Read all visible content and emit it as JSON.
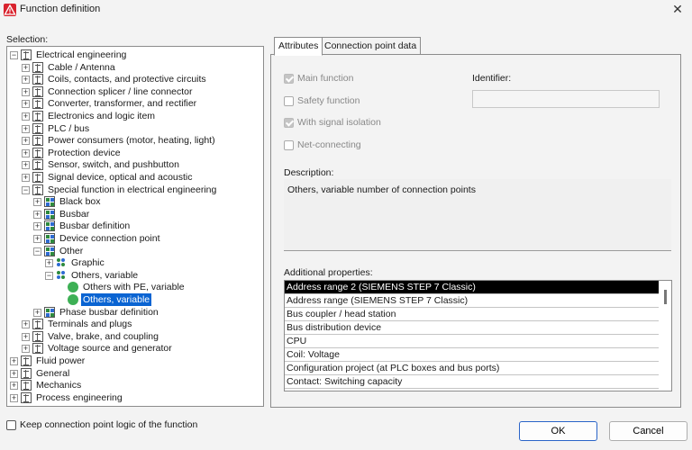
{
  "window": {
    "title": "Function definition"
  },
  "selection_label": "Selection:",
  "tree": [
    {
      "label": "Electrical engineering",
      "level": 0,
      "expander": "−",
      "icon": "grid-icon"
    },
    {
      "label": "Cable / Antenna",
      "level": 1,
      "expander": "+",
      "icon": "grid-icon"
    },
    {
      "label": "Coils, contacts, and protective circuits",
      "level": 1,
      "expander": "+",
      "icon": "grid-icon"
    },
    {
      "label": "Connection splicer / line connector",
      "level": 1,
      "expander": "+",
      "icon": "grid-icon"
    },
    {
      "label": "Converter, transformer, and rectifier",
      "level": 1,
      "expander": "+",
      "icon": "grid-icon"
    },
    {
      "label": "Electronics and logic item",
      "level": 1,
      "expander": "+",
      "icon": "grid-icon"
    },
    {
      "label": "PLC / bus",
      "level": 1,
      "expander": "+",
      "icon": "grid-icon"
    },
    {
      "label": "Power consumers (motor, heating, light)",
      "level": 1,
      "expander": "+",
      "icon": "grid-icon"
    },
    {
      "label": "Protection device",
      "level": 1,
      "expander": "+",
      "icon": "grid-icon"
    },
    {
      "label": "Sensor, switch, and pushbutton",
      "level": 1,
      "expander": "+",
      "icon": "grid-icon"
    },
    {
      "label": "Signal device, optical and acoustic",
      "level": 1,
      "expander": "+",
      "icon": "grid-icon"
    },
    {
      "label": "Special function in electrical engineering",
      "level": 1,
      "expander": "−",
      "icon": "grid-icon"
    },
    {
      "label": "Black box",
      "level": 2,
      "expander": "+",
      "icon": "blue-grid-icon"
    },
    {
      "label": "Busbar",
      "level": 2,
      "expander": "+",
      "icon": "blue-grid-icon"
    },
    {
      "label": "Busbar definition",
      "level": 2,
      "expander": "+",
      "icon": "blue-grid-icon"
    },
    {
      "label": "Device connection point",
      "level": 2,
      "expander": "+",
      "icon": "blue-grid-icon"
    },
    {
      "label": "Other",
      "level": 2,
      "expander": "−",
      "icon": "blue-grid-icon"
    },
    {
      "label": "Graphic",
      "level": 3,
      "expander": "+",
      "icon": "dots-icon"
    },
    {
      "label": "Others, variable",
      "level": 3,
      "expander": "−",
      "icon": "dots-icon"
    },
    {
      "label": "Others with PE, variable",
      "level": 4,
      "expander": "",
      "icon": "green-dot-icon"
    },
    {
      "label": "Others, variable",
      "level": 4,
      "expander": "",
      "icon": "green-dot-icon",
      "selected": true
    },
    {
      "label": "Phase busbar definition",
      "level": 2,
      "expander": "+",
      "icon": "blue-grid-icon"
    },
    {
      "label": "Terminals and plugs",
      "level": 1,
      "expander": "+",
      "icon": "grid-icon"
    },
    {
      "label": "Valve, brake, and coupling",
      "level": 1,
      "expander": "+",
      "icon": "grid-icon"
    },
    {
      "label": "Voltage source and generator",
      "level": 1,
      "expander": "+",
      "icon": "grid-icon"
    },
    {
      "label": "Fluid power",
      "level": 0,
      "expander": "+",
      "icon": "grid-icon"
    },
    {
      "label": "General",
      "level": 0,
      "expander": "+",
      "icon": "grid-icon"
    },
    {
      "label": "Mechanics",
      "level": 0,
      "expander": "+",
      "icon": "grid-icon"
    },
    {
      "label": "Process engineering",
      "level": 0,
      "expander": "+",
      "icon": "grid-icon"
    }
  ],
  "tabs": [
    {
      "label": "Attributes",
      "active": true
    },
    {
      "label": "Connection point data",
      "active": false
    }
  ],
  "attributes": {
    "main_function": {
      "label": "Main function",
      "checked": true
    },
    "safety_function": {
      "label": "Safety function",
      "checked": false
    },
    "with_signal_isolation": {
      "label": "With signal isolation",
      "checked": true
    },
    "net_connecting": {
      "label": "Net-connecting",
      "checked": false
    },
    "identifier_label": "Identifier:",
    "identifier_value": "",
    "description_label": "Description:",
    "description_value": "Others, variable number of connection points",
    "additional_label": "Additional properties:",
    "additional_properties": [
      "Address range 2 (SIEMENS STEP 7 Classic)",
      "Address range (SIEMENS STEP 7 Classic)",
      "Bus coupler / head station",
      "Bus distribution device",
      "CPU",
      "Coil: Voltage",
      "Configuration project (at PLC boxes and bus ports)",
      "Contact: Switching capacity"
    ],
    "additional_selected_index": 0
  },
  "keep_logic": {
    "label": "Keep connection point logic of the function",
    "checked": false
  },
  "buttons": {
    "ok": "OK",
    "cancel": "Cancel"
  },
  "colors": {
    "selection": "#0a64d2",
    "brand": "#d9232e",
    "property_selection": "#000000"
  }
}
